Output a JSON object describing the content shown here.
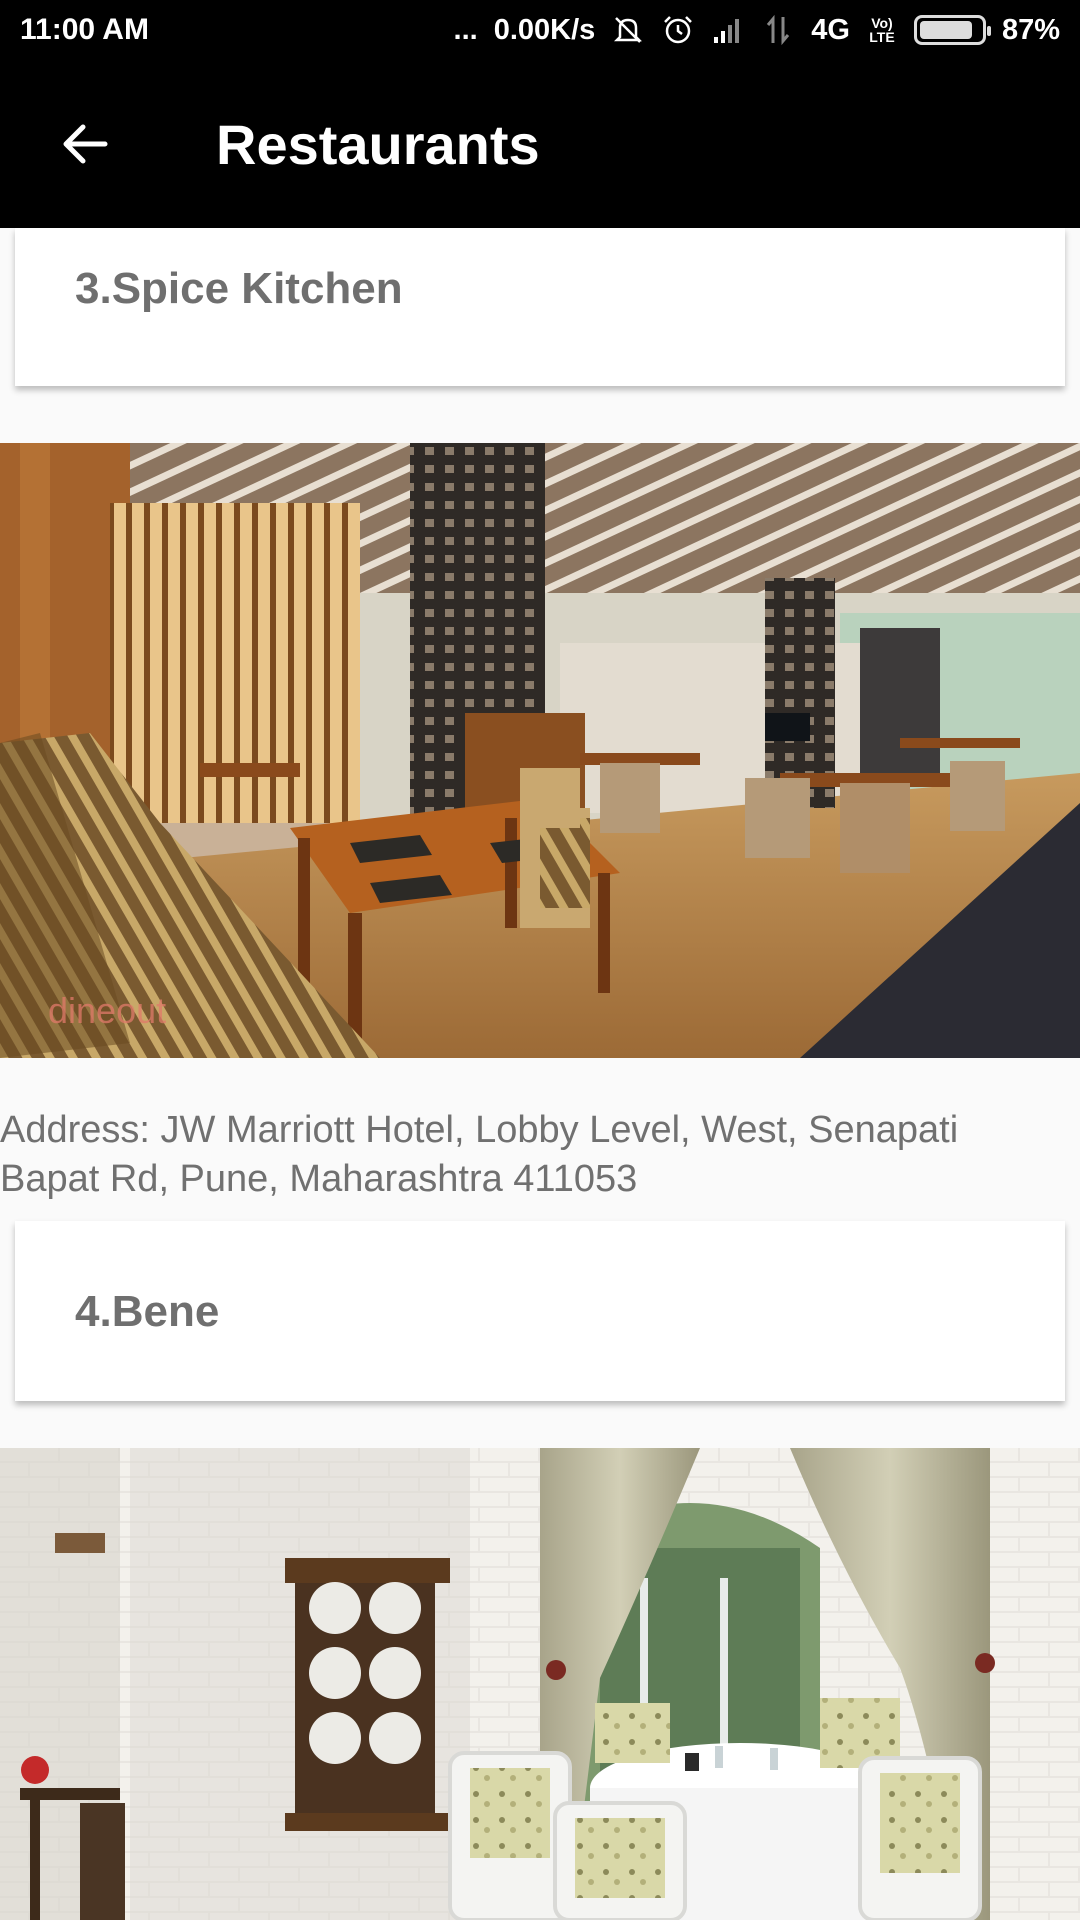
{
  "status_bar": {
    "time": "11:00 AM",
    "dots": "...",
    "net_speed": "0.00K/s",
    "network_type": "4G",
    "volte": "Vo) LTE",
    "battery": "87%",
    "battery_level": 0.87,
    "icons": [
      "muted-icon",
      "alarm-icon",
      "signal-icon",
      "data-icon",
      "battery-icon"
    ]
  },
  "app_bar": {
    "title": "Restaurants",
    "back_icon": "arrow-left-icon"
  },
  "restaurants": [
    {
      "title": "3.Spice Kitchen",
      "image": "restaurant interior with wooden tables, striped chairs and slatted ceiling",
      "watermark": "dineout",
      "address": "Address: JW Marriott Hotel, Lobby Level, West, Senapati Bapat Rd, Pune, Maharashtra 411053"
    },
    {
      "title": "4.Bene",
      "image": "white brick dining room with curtains and round table"
    }
  ],
  "colors": {
    "bar": "#000000",
    "background": "#fafafa",
    "card": "#ffffff",
    "title_text": "#6f6f6f",
    "address_text": "#707070"
  }
}
